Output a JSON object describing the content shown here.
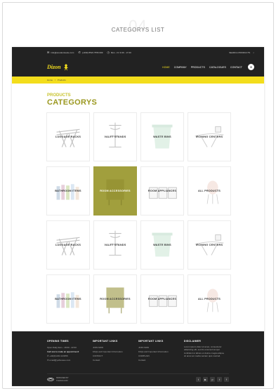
{
  "page": {
    "number": "04",
    "title": "CATEGORYS LIST"
  },
  "topbar": {
    "email": "info@woodentoeste.com",
    "phone": "(+999) 8523 7556 999",
    "hours": "Mon - Fri 9.30 - 17.00",
    "search_label": "SEARCH PRODUCTS"
  },
  "logo": {
    "text": "Dizon"
  },
  "menu": {
    "items": [
      {
        "label": "HOME",
        "active": true
      },
      {
        "label": "COMPANY",
        "active": false
      },
      {
        "label": "PRODUCTS",
        "active": false
      },
      {
        "label": "CATALOGUES",
        "active": false
      },
      {
        "label": "CONTACT",
        "active": false
      }
    ],
    "cart_icon": "cart-icon"
  },
  "breadcrumb": {
    "home": "Home",
    "sep": "/",
    "current": "Products"
  },
  "heading": {
    "small": "PRODUCTS",
    "big": "CATEGORYS"
  },
  "tiles": [
    {
      "label": "LUGGAGE RACKS",
      "icon": "luggage-rack",
      "highlight": false
    },
    {
      "label": "VALET STANDS",
      "icon": "valet-stand",
      "highlight": false
    },
    {
      "label": "WASTE BINS",
      "icon": "waste-bin",
      "highlight": false
    },
    {
      "label": "IRONING CENTERS",
      "icon": "ironing",
      "highlight": false
    },
    {
      "label": "BATHROOM ITEMS",
      "icon": "bathroom",
      "highlight": false
    },
    {
      "label": "ROOM ACCESSORIES",
      "icon": "room-accessories",
      "highlight": true
    },
    {
      "label": "ROOM APPLIANCES",
      "icon": "room-appliances",
      "highlight": false
    },
    {
      "label": "ALL PRODUCTS",
      "icon": "all-products",
      "highlight": false
    },
    {
      "label": "LUGGAGE RACKS",
      "icon": "luggage-rack",
      "highlight": false
    },
    {
      "label": "VALET STANDS",
      "icon": "valet-stand",
      "highlight": false
    },
    {
      "label": "WASTE BINS",
      "icon": "waste-bin",
      "highlight": false
    },
    {
      "label": "IRONING CENTERS",
      "icon": "ironing",
      "highlight": false
    },
    {
      "label": "BATHROOM ITEMS",
      "icon": "bathroom",
      "highlight": false
    },
    {
      "label": "ROOM ACCESSORIES",
      "icon": "room-accessories",
      "highlight": false
    },
    {
      "label": "ROOM APPLIANCES",
      "icon": "room-appliances",
      "highlight": false
    },
    {
      "label": "ALL PRODUCTS",
      "icon": "all-products",
      "highlight": false
    }
  ],
  "footer": {
    "col1": {
      "title": "OPENING TIMES",
      "hours": "Open Daily 9am - 18:00 - 22:00",
      "cta": "Call now to make an appointment!",
      "phone": "+44(0)1234 123456",
      "email": "email@yahooeee.com"
    },
    "col2": {
      "title": "IMPORTANT LINKS",
      "links": [
        "JOIN NOW",
        "FAQs and Important Information",
        "CONTACT",
        "Contact"
      ]
    },
    "col3": {
      "title": "IMPORTANT LINKS",
      "links": [
        "JOIN NOW",
        "FAQs and Important Information",
        "COMPLAIN",
        "Contact"
      ]
    },
    "col4": {
      "title": "DISCLAIMER",
      "text": "Lorem ipsum dolor sit amet, consectetur adipiscing elit, sed do eiusmod tempor incididunt ut labore et dolore magna aliqua, sit amet ac media veniam quis nostrud."
    },
    "copyright": {
      "line1": "DESIGNED BY",
      "line2": "CreativeLookit"
    },
    "social": [
      "twitter",
      "youtube",
      "pinterest",
      "twitter",
      "facebook"
    ],
    "social_glyphs": [
      "t",
      "▶",
      "p",
      "t",
      "f"
    ]
  },
  "colors": {
    "accent": "#f3dd1c",
    "olive": "#a19f3d",
    "dark": "#222222"
  }
}
